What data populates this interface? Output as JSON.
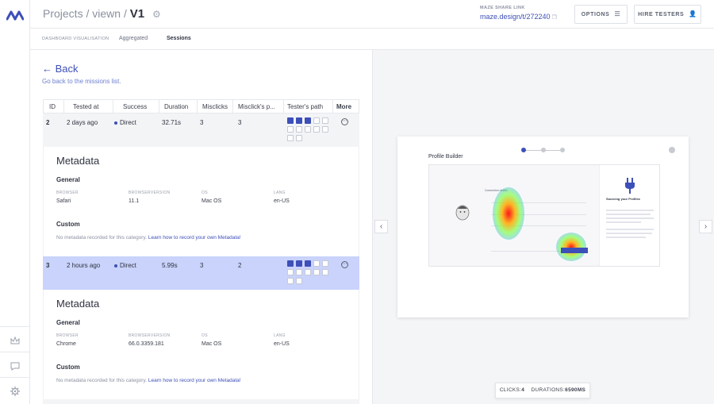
{
  "header": {
    "breadcrumb": [
      "Projects",
      "viewn"
    ],
    "separator": "/",
    "current": "V1",
    "share_label": "MAZE SHARE LINK",
    "share_link": "maze.design/t/272240",
    "options_label": "OPTIONS",
    "hire_label": "HIRE TESTERS"
  },
  "subtabs": [
    "DASHBOARD VISUALISATION",
    "Aggregated",
    "Sessions"
  ],
  "back": {
    "label": "Back",
    "subtitle": "Go back to the missions list."
  },
  "table": {
    "columns": [
      "ID",
      "Tested at",
      "Success",
      "Duration",
      "Misclicks",
      "Misclick's p...",
      "Tester's path",
      "More"
    ],
    "rows": [
      {
        "id": "2",
        "tested_at": "2 days ago",
        "success": "Direct",
        "duration": "32.71s",
        "misclicks": "3",
        "misclick_pct": "3"
      },
      {
        "id": "3",
        "tested_at": "2 hours ago",
        "success": "Direct",
        "duration": "5.99s",
        "misclicks": "3",
        "misclick_pct": "2"
      }
    ]
  },
  "metadata": [
    {
      "title": "Metadata",
      "general": "General",
      "labels": [
        "BROWSER",
        "BROWSERVERSION",
        "OS",
        "LANG"
      ],
      "values": [
        "Safari",
        "11.1",
        "Mac OS",
        "en-US"
      ],
      "custom": "Custom",
      "none_text": "No metadata recorded for this category.",
      "link_text": "Learn how to record your own Metadata!"
    },
    {
      "title": "Metadata",
      "general": "General",
      "labels": [
        "BROWSER",
        "BROWSERVERSION",
        "OS",
        "LANG"
      ],
      "values": [
        "Chrome",
        "66.0.3359.181",
        "Mac OS",
        "en-US"
      ],
      "custom": "Custom",
      "none_text": "No metadata recorded for this category.",
      "link_text": "Learn how to record your own Metadata!"
    }
  ],
  "preview": {
    "title": "Profile Builder",
    "screen_left_title": "Connection details",
    "screen_right_title": "Sourcing your Profiles",
    "clicks_label": "CLICKS:",
    "clicks_value": "4",
    "durations_label": "DURATIONS:",
    "durations_value": "6590MS"
  },
  "colors": {
    "accent": "#3d4fb8",
    "selected_row": "#c9d3fb"
  }
}
